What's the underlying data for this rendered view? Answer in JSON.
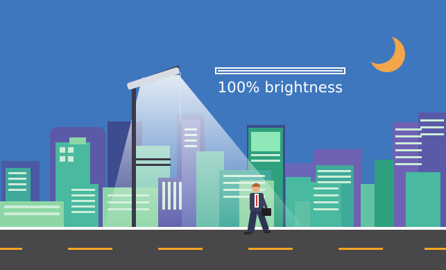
{
  "status": {
    "brightness_percent": 100,
    "brightness_text": "100% brightness"
  },
  "colors": {
    "sky": "#3e77bd",
    "moon": "#f2a54a",
    "road": "#48484a",
    "lane_marking": "#f5a623",
    "light_beam": "#ffffff",
    "building_teal": "#49b9a0",
    "building_purple": "#5a5aa8",
    "building_green": "#8fd6a6"
  },
  "icons": {
    "moon": "crescent-moon-icon",
    "lamp": "street-lamp-icon",
    "person": "walking-businessman-icon"
  }
}
